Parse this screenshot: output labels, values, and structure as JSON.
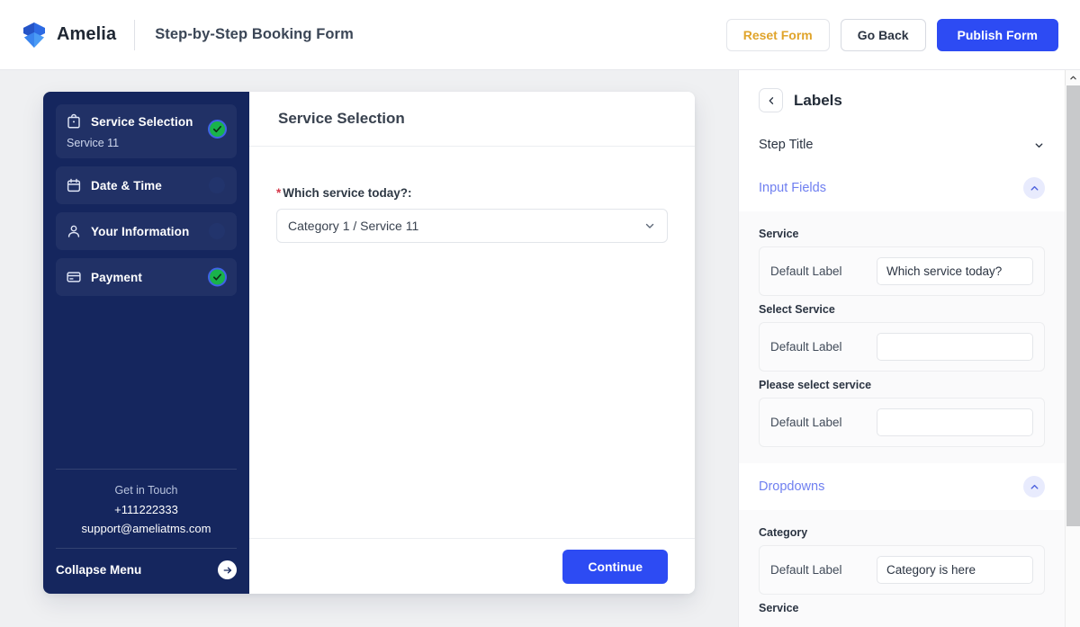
{
  "header": {
    "brand": "Amelia",
    "logo_icon": "amelia-cube-logo",
    "page_title": "Step-by-Step Booking Form",
    "buttons": {
      "reset": "Reset Form",
      "go_back": "Go Back",
      "publish": "Publish Form"
    },
    "colors": {
      "reset_text": "#e0a42b",
      "publish_bg": "#2d4bf3",
      "go_back_text": "#2b3442"
    }
  },
  "booking_form": {
    "sidebar": {
      "steps": [
        {
          "label": "Service Selection",
          "icon": "shopping-bag-icon",
          "sub": "Service 11",
          "status": "complete"
        },
        {
          "label": "Date & Time",
          "icon": "calendar-icon",
          "sub": "",
          "status": "pending"
        },
        {
          "label": "Your Information",
          "icon": "user-icon",
          "sub": "",
          "status": "pending"
        },
        {
          "label": "Payment",
          "icon": "credit-card-icon",
          "sub": "",
          "status": "complete"
        }
      ],
      "contact": {
        "heading": "Get in Touch",
        "phone": "+111222333",
        "email": "support@ameliatms.com"
      },
      "collapse_label": "Collapse Menu",
      "collapse_icon": "arrow-right-circle-icon",
      "bg_color": "#15265e"
    },
    "step_header_title": "Service Selection",
    "field": {
      "required_marker": "*",
      "label": "Which service today?:",
      "select_value": "Category 1 / Service 11",
      "select_icon": "chevron-down-icon"
    },
    "footer": {
      "continue_label": "Continue"
    }
  },
  "right_panel": {
    "back_icon": "chevron-left-icon",
    "title": "Labels",
    "sections": [
      {
        "name": "Step Title",
        "state": "collapsed",
        "chevron_icon": "chevron-down-icon",
        "groups": []
      },
      {
        "name": "Input Fields",
        "state": "expanded",
        "chevron_icon": "chevron-up-icon",
        "groups": [
          {
            "title": "Service",
            "key": "Default Label",
            "value": "Which service today?"
          },
          {
            "title": "Select Service",
            "key": "Default Label",
            "value": ""
          },
          {
            "title": "Please select service",
            "key": "Default Label",
            "value": ""
          }
        ]
      },
      {
        "name": "Dropdowns",
        "state": "expanded",
        "chevron_icon": "chevron-up-icon",
        "groups": [
          {
            "title": "Category",
            "key": "Default Label",
            "value": "Category is here"
          },
          {
            "title": "Service",
            "key": "Default Label",
            "value": ""
          }
        ]
      }
    ],
    "accent_color": "#6f7ff0"
  },
  "scrollbar": {
    "up_icon": "chevron-up-icon",
    "position": "right"
  }
}
